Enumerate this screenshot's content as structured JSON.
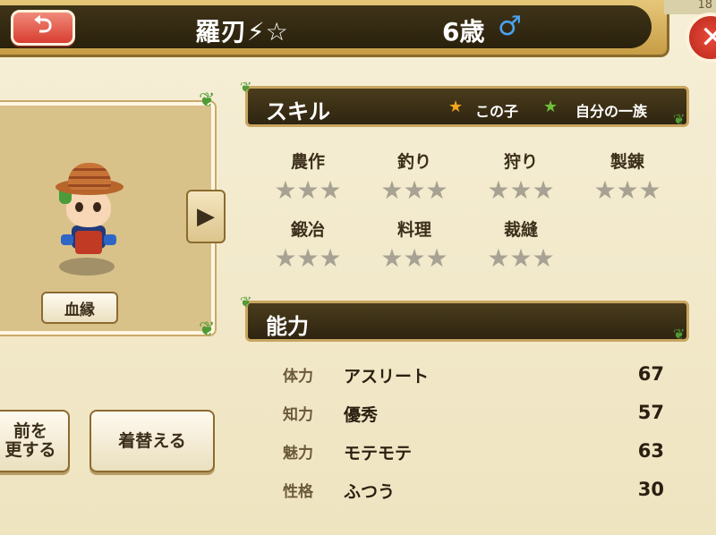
{
  "header": {
    "back_label": "⮌",
    "name": "羅刃⚡☆",
    "age": "6歳",
    "gender_symbol": "♂",
    "corner_number": "18",
    "close_label": "✕"
  },
  "character": {
    "blood_button": "血縁",
    "next_arrow": "▶"
  },
  "buttons": {
    "rename": "前を\n更する",
    "change_clothes": "着替える"
  },
  "skills": {
    "title": "スキル",
    "legend_child": "この子",
    "legend_clan": "自分の一族",
    "items": [
      {
        "label": "農作",
        "stars": "★★★"
      },
      {
        "label": "釣り",
        "stars": "★★★"
      },
      {
        "label": "狩り",
        "stars": "★★★"
      },
      {
        "label": "製錬",
        "stars": "★★★"
      },
      {
        "label": "鍛冶",
        "stars": "★★★"
      },
      {
        "label": "料理",
        "stars": "★★★"
      },
      {
        "label": "裁縫",
        "stars": "★★★"
      }
    ],
    "filled_star_color": "#f2a520",
    "clan_star_color": "#6fbf3a",
    "empty_star_color": "#a7a293"
  },
  "abilities": {
    "title": "能力",
    "rows": [
      {
        "key": "体力",
        "name": "アスリート",
        "value": "67"
      },
      {
        "key": "知力",
        "name": "優秀",
        "value": "57"
      },
      {
        "key": "魅力",
        "name": "モテモテ",
        "value": "63"
      },
      {
        "key": "性格",
        "name": "ふつう",
        "value": "30"
      }
    ]
  }
}
